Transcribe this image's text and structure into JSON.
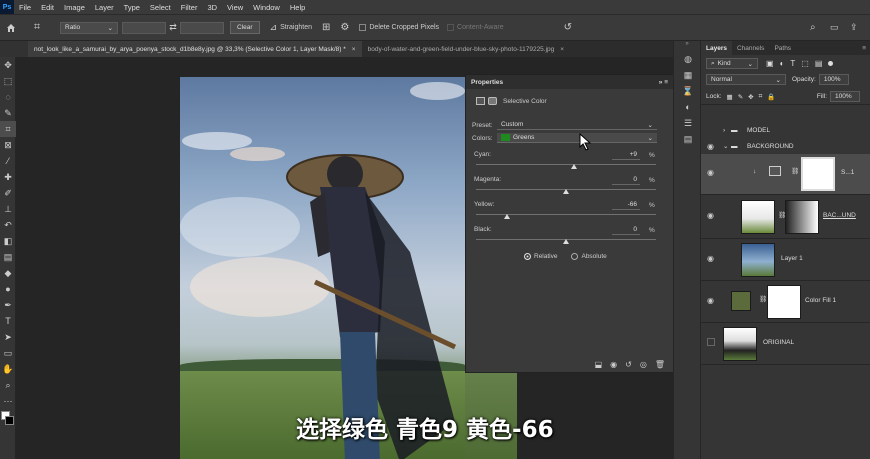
{
  "menubar": {
    "logo": "Ps",
    "items": [
      "File",
      "Edit",
      "Image",
      "Layer",
      "Type",
      "Select",
      "Filter",
      "3D",
      "View",
      "Window",
      "Help"
    ]
  },
  "options_bar": {
    "ratio_label": "Ratio",
    "clear_label": "Clear",
    "straighten_label": "Straighten",
    "delete_cropped_label": "Delete Cropped Pixels",
    "content_aware_label": "Content-Aware"
  },
  "tabs": [
    {
      "label": "not_look_like_a_samurai_by_arya_poenya_stock_d1b8e8y.jpg @ 33,3% (Selective Color 1, Layer Mask/8) *"
    },
    {
      "label": "body-of-water-and-green-field-under-blue-sky-photo-1179225.jpg"
    }
  ],
  "properties": {
    "title": "Properties",
    "adjustment_name": "Selective Color",
    "preset_label": "Preset:",
    "preset_value": "Custom",
    "colors_label": "Colors:",
    "colors_value": "Greens",
    "colors_swatch": "#1f8a1f",
    "sliders": [
      {
        "label": "Cyan:",
        "value": "+9",
        "unit": "%",
        "level": 0.545
      },
      {
        "label": "Magenta:",
        "value": "0",
        "unit": "%",
        "level": 0.5
      },
      {
        "label": "Yellow:",
        "value": "-66",
        "unit": "%",
        "level": 0.17
      },
      {
        "label": "Black:",
        "value": "0",
        "unit": "%",
        "level": 0.5
      }
    ],
    "method_relative": "Relative",
    "method_absolute": "Absolute",
    "method_selected": "Relative"
  },
  "layers_panel": {
    "tabs": [
      "Layers",
      "Channels",
      "Paths"
    ],
    "filter_kind": "Kind",
    "blend_mode": "Normal",
    "opacity_label": "Opacity:",
    "opacity_value": "100%",
    "lock_label": "Lock:",
    "fill_label": "Fill:",
    "fill_value": "100%",
    "layers": [
      {
        "name": "MODEL",
        "type": "group"
      },
      {
        "name": "BACKGROUND",
        "type": "group"
      },
      {
        "name": "S...1",
        "type": "adjustment"
      },
      {
        "name": "BAC...UND",
        "type": "image"
      },
      {
        "name": "Layer 1",
        "type": "image"
      },
      {
        "name": "Color Fill 1",
        "type": "fill",
        "fill_color": "#5c6b3c"
      },
      {
        "name": "ORIGINAL",
        "type": "image"
      }
    ]
  },
  "subtitle": "选择绿色 青色9 黄色-66",
  "colors": {
    "accent": "#31a8ff",
    "panel_bg": "#3a3a3a",
    "app_bg": "#323232"
  }
}
